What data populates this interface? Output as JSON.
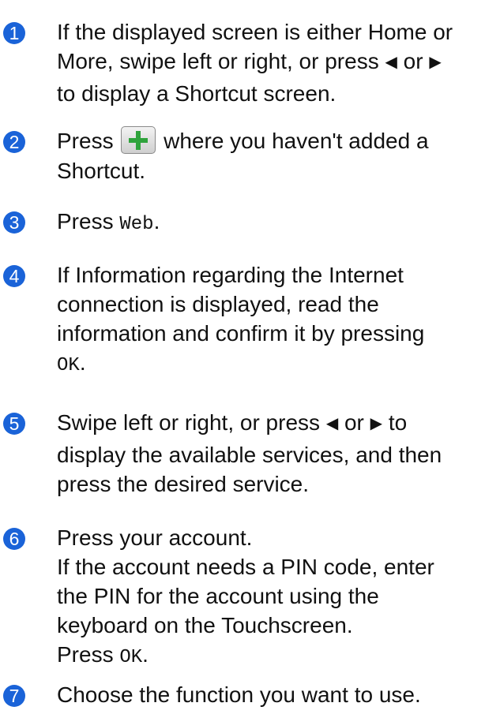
{
  "steps": [
    {
      "number": "1",
      "line1": "If the displayed screen is either Home or",
      "line2a": "More, swipe left or right, or press",
      "or": "or",
      "line3": "to display a Shortcut screen.",
      "icons": [
        "left-arrow-icon",
        "right-arrow-icon"
      ]
    },
    {
      "number": "2",
      "press": "Press",
      "after_icon": "where you haven't added a",
      "line2": "Shortcut.",
      "icon": "plus-icon"
    },
    {
      "number": "3",
      "press": "Press",
      "code": "Web",
      "end": "."
    },
    {
      "number": "4",
      "line1": "If Information regarding the Internet",
      "line2": "connection is displayed, read the",
      "line3": "information and confirm it by pressing",
      "code": "OK",
      "end": "."
    },
    {
      "number": "5",
      "line1a": "Swipe left or right, or press",
      "or": "or",
      "line1b": "to",
      "line2": "display the available services, and then",
      "line3": "press the desired service.",
      "icons": [
        "left-arrow-icon",
        "right-arrow-icon"
      ]
    },
    {
      "number": "6",
      "line1": "Press your account.",
      "line2": "If the account needs a PIN code, enter",
      "line3": "the PIN for the account using the",
      "line4": "keyboard on the Touchscreen.",
      "press": "Press",
      "code": "OK",
      "end": "."
    },
    {
      "number": "7",
      "line1": "Choose the function you want to use."
    }
  ],
  "colors": {
    "badge": "#1a63d8",
    "icon_button_plus": "#2fa33c"
  }
}
